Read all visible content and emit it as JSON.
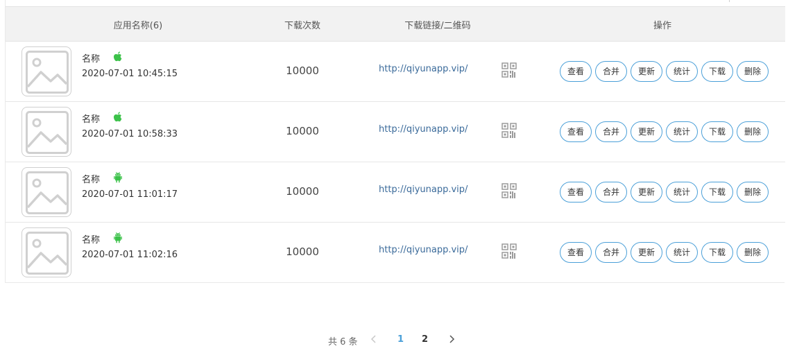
{
  "table": {
    "headers": {
      "app_name": "应用名称(6)",
      "downloads": "下载次数",
      "link": "下载链接/二维码",
      "ops": "操作"
    },
    "rows": [
      {
        "name": "名称",
        "os": "apple",
        "time": "2020-07-01 10:45:15",
        "downloads": "10000",
        "link": "http://qiyunapp.vip/"
      },
      {
        "name": "名称",
        "os": "apple",
        "time": "2020-07-01 10:58:33",
        "downloads": "10000",
        "link": "http://qiyunapp.vip/"
      },
      {
        "name": "名称",
        "os": "android",
        "time": "2020-07-01 11:01:17",
        "downloads": "10000",
        "link": "http://qiyunapp.vip/"
      },
      {
        "name": "名称",
        "os": "android",
        "time": "2020-07-01 11:02:16",
        "downloads": "10000",
        "link": "http://qiyunapp.vip/"
      }
    ],
    "actions": [
      "查看",
      "合并",
      "更新",
      "统计",
      "下载",
      "删除"
    ]
  },
  "pagination": {
    "total_label": "共 6 条",
    "pages": [
      "1",
      "2"
    ],
    "current_page": "1"
  },
  "colors": {
    "accent": "#4a9fd8",
    "os_icon": "#3cc24a",
    "header_bg": "#f2f2f2",
    "link": "#3a6a9a"
  }
}
